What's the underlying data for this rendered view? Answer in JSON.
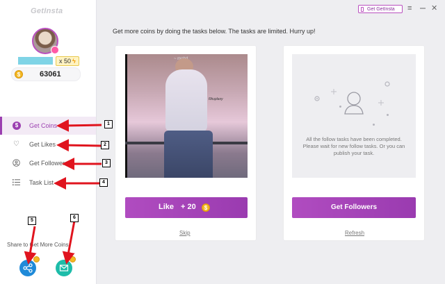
{
  "app": {
    "logo": "GetInsta"
  },
  "profile": {
    "multiplier": "x 50",
    "coins": "63061"
  },
  "nav": [
    {
      "label": "Get Coins",
      "icon": "coin-nav-icon",
      "active": true
    },
    {
      "label": "Get Likes",
      "icon": "heart-icon"
    },
    {
      "label": "Get Followers",
      "icon": "user-circle-icon"
    },
    {
      "label": "Task List",
      "icon": "list-icon"
    }
  ],
  "share": {
    "text": "Share to Get More Coins"
  },
  "topbar": {
    "button": "Get GetInsta",
    "menu_icon": "≡",
    "close_icon": "✕"
  },
  "main": {
    "instruction": "Get more coins by doing the tasks below. The tasks are limited. Hurry up!",
    "like_card": {
      "button_label": "Like",
      "reward": "+ 20",
      "skip": "Skip",
      "photo_caption": "~ mohd",
      "photo_watermark": "Rkuplaxy"
    },
    "follow_card": {
      "empty_message": "All the follow tasks have been completed. Please wait for new follow tasks. Or you can publish your task.",
      "button_label": "Get Followers",
      "refresh": "Refresh"
    }
  },
  "annotations": [
    "1",
    "2",
    "3",
    "4",
    "5",
    "6"
  ],
  "colors": {
    "accent": "#9b3fb0",
    "coin": "#f3b823",
    "share": "#1f8ad8",
    "mail": "#1dbca9",
    "arrow": "#e0141e"
  }
}
